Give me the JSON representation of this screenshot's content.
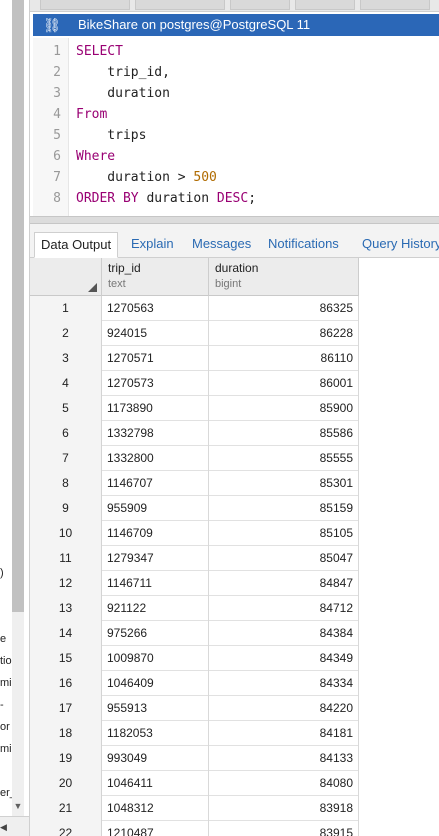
{
  "query_tab": {
    "title": "BikeShare on postgres@PostgreSQL 11",
    "icon": "link-icon"
  },
  "editor": {
    "lines": [
      {
        "num": "1",
        "tokens": [
          {
            "t": "SELECT",
            "k": "kw"
          }
        ]
      },
      {
        "num": "2",
        "tokens": [
          {
            "t": "    trip_id,",
            "k": ""
          }
        ]
      },
      {
        "num": "3",
        "tokens": [
          {
            "t": "    duration",
            "k": ""
          }
        ]
      },
      {
        "num": "4",
        "tokens": [
          {
            "t": "From",
            "k": "kw"
          }
        ]
      },
      {
        "num": "5",
        "tokens": [
          {
            "t": "    trips",
            "k": ""
          }
        ]
      },
      {
        "num": "6",
        "tokens": [
          {
            "t": "Where",
            "k": "kw"
          }
        ]
      },
      {
        "num": "7",
        "tokens": [
          {
            "t": "    duration > ",
            "k": ""
          },
          {
            "t": "500",
            "k": "num"
          }
        ]
      },
      {
        "num": "8",
        "tokens": [
          {
            "t": "ORDER BY",
            "k": "kw"
          },
          {
            "t": " duration ",
            "k": ""
          },
          {
            "t": "DESC",
            "k": "kw"
          },
          {
            "t": ";",
            "k": ""
          }
        ]
      }
    ]
  },
  "output_tabs": [
    {
      "label": "Data Output",
      "active": true
    },
    {
      "label": "Explain",
      "active": false
    },
    {
      "label": "Messages",
      "active": false
    },
    {
      "label": "Notifications",
      "active": false
    },
    {
      "label": "Query History",
      "active": false
    }
  ],
  "grid": {
    "columns": [
      {
        "name": "trip_id",
        "type": "text"
      },
      {
        "name": "duration",
        "type": "bigint"
      }
    ],
    "rows": [
      [
        "1",
        "1270563",
        "86325"
      ],
      [
        "2",
        "924015",
        "86228"
      ],
      [
        "3",
        "1270571",
        "86110"
      ],
      [
        "4",
        "1270573",
        "86001"
      ],
      [
        "5",
        "1173890",
        "85900"
      ],
      [
        "6",
        "1332798",
        "85586"
      ],
      [
        "7",
        "1332800",
        "85555"
      ],
      [
        "8",
        "1146707",
        "85301"
      ],
      [
        "9",
        "955909",
        "85159"
      ],
      [
        "10",
        "1146709",
        "85105"
      ],
      [
        "11",
        "1279347",
        "85047"
      ],
      [
        "12",
        "1146711",
        "84847"
      ],
      [
        "13",
        "921122",
        "84712"
      ],
      [
        "14",
        "975266",
        "84384"
      ],
      [
        "15",
        "1009870",
        "84349"
      ],
      [
        "16",
        "1046409",
        "84334"
      ],
      [
        "17",
        "955913",
        "84220"
      ],
      [
        "18",
        "1182053",
        "84181"
      ],
      [
        "19",
        "993049",
        "84133"
      ],
      [
        "20",
        "1046411",
        "84080"
      ],
      [
        "21",
        "1048312",
        "83918"
      ],
      [
        "22",
        "1210487",
        "83915"
      ]
    ]
  },
  "left_panel_fragments": [
    ")",
    "",
    "",
    "e",
    "tio",
    "mi",
    "-",
    "or",
    "mi",
    "",
    "er_"
  ],
  "colors": {
    "title_bar": "#2b67b7",
    "keyword": "#990073",
    "number": "#b06b00",
    "tab_link": "#2a6ab3"
  }
}
